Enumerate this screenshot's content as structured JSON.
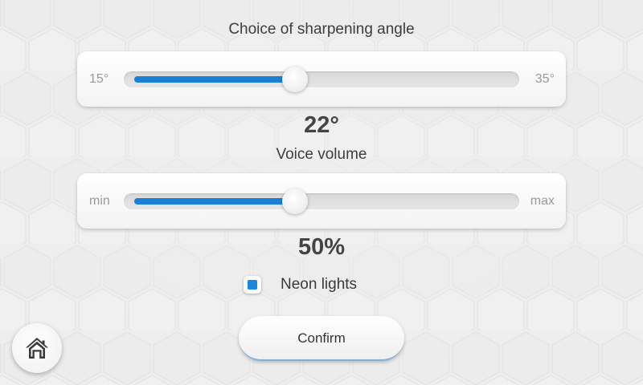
{
  "sharpening": {
    "title": "Choice of sharpening angle",
    "min_label": "15°",
    "max_label": "35°",
    "value_display": "22°",
    "level_fraction": 0.43
  },
  "voice": {
    "title": "Voice volume",
    "min_label": "min",
    "max_label": "max",
    "value_display": "50%",
    "level_fraction": 0.43
  },
  "neon": {
    "label": "Neon lights",
    "checked": true
  },
  "confirm_label": "Confirm",
  "home_icon": "home-icon",
  "colors": {
    "accent": "#1c7fd6",
    "background": "#ededed"
  }
}
